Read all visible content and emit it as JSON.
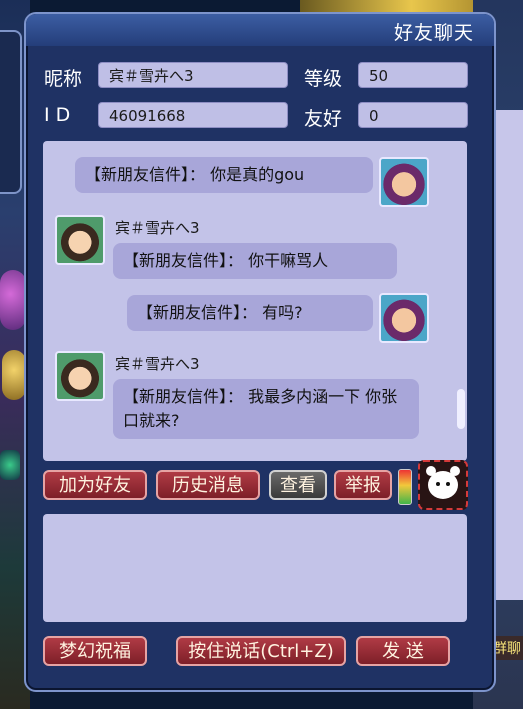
{
  "window": {
    "title": "好友聊天"
  },
  "profile": {
    "nickname_label": "昵称",
    "nickname_value": "宾＃雪卉へ3",
    "level_label": "等级",
    "level_value": "50",
    "id_label": "I D",
    "id_value": "46091668",
    "friendship_label": "友好",
    "friendship_value": "0"
  },
  "chat": {
    "messages": [
      {
        "sender": "",
        "text": "【新朋友信件】： 你是真的gou"
      },
      {
        "sender": "宾＃雪卉へ3",
        "text": "【新朋友信件】： 你干嘛骂人"
      },
      {
        "sender": "",
        "text": "【新朋友信件】： 有吗?"
      },
      {
        "sender": "宾＃雪卉へ3",
        "text": "【新朋友信件】： 我最多内涵一下 你张口就来?"
      }
    ]
  },
  "actions": {
    "add_friend": "加为好友",
    "history": "历史消息",
    "view": "查看",
    "report": "举报"
  },
  "bottom": {
    "blessing": "梦幻祝福",
    "voice": "按住说话(Ctrl+Z)",
    "send": "发 送"
  },
  "side": {
    "group_chat": "群聊"
  },
  "colors": {
    "window_bg": "#1f3264",
    "panel_bg": "#c3c3e8",
    "bubble_bg": "#a8a6d9",
    "button_red": "#9a2e37"
  }
}
